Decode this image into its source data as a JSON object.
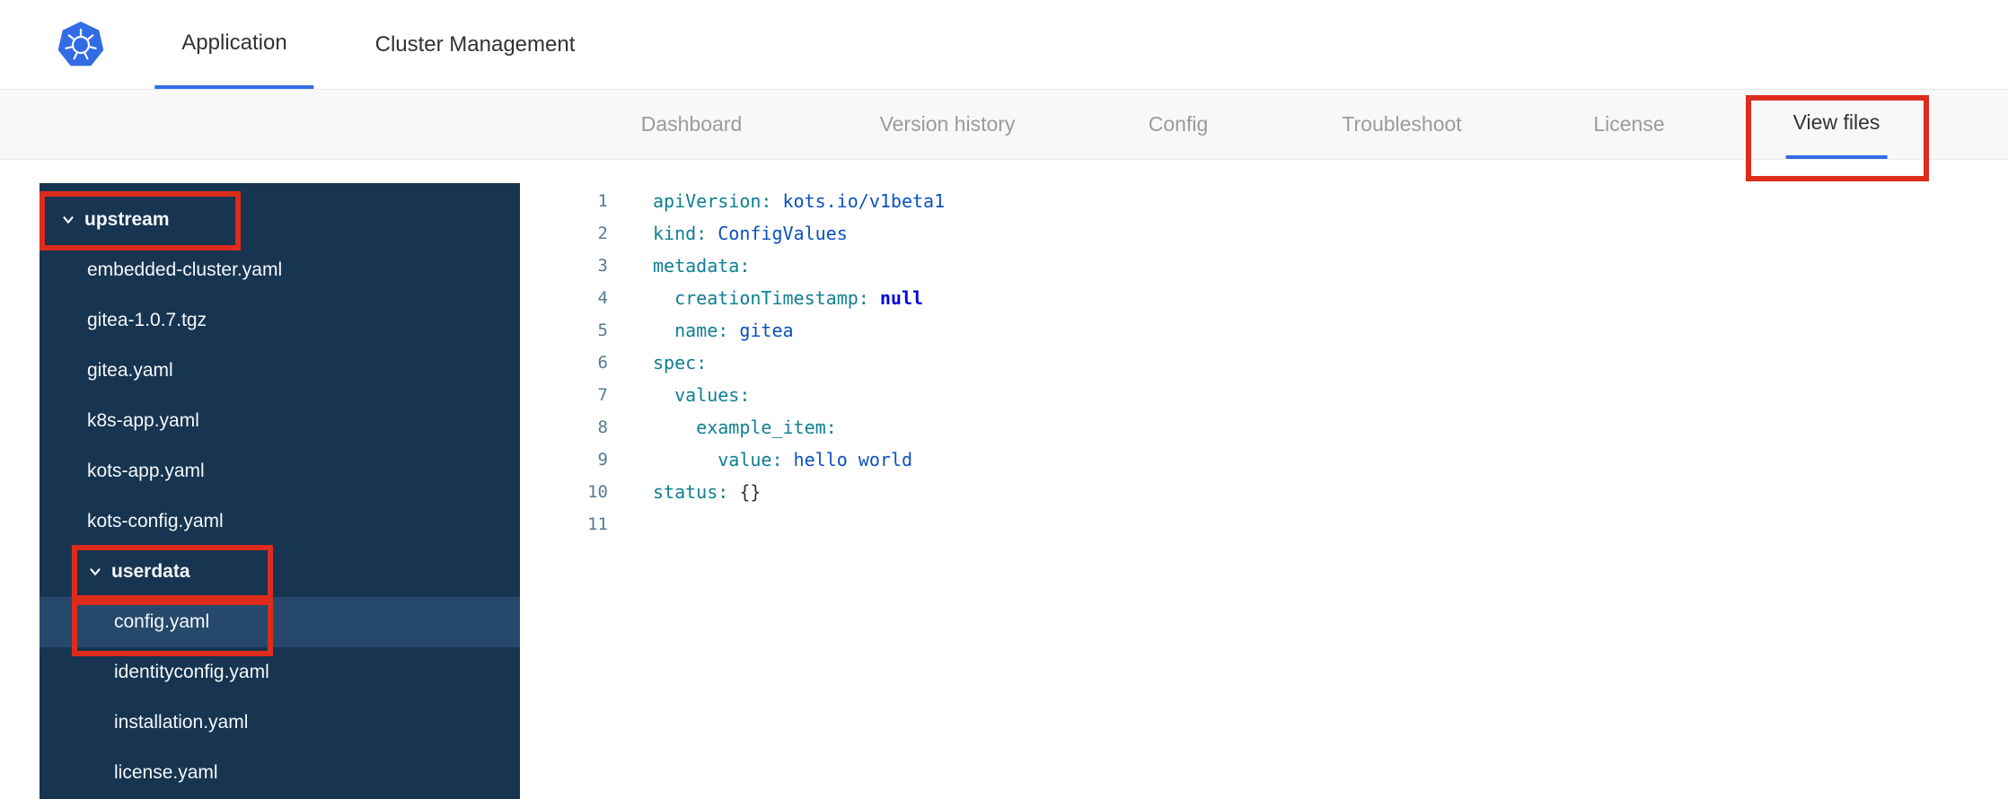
{
  "colors": {
    "accent-blue": "#326de6",
    "annotation-red": "#dd2b1c",
    "sidebar-bg": "#173450",
    "sidebar-selected": "#26496b",
    "nav-inactive": "#9b9b9b",
    "text-dark": "#323232",
    "code-key": "#0e7f93",
    "code-val": "#0b50c0",
    "code-kw": "#0000e0",
    "code-punct": "#333333",
    "line-num": "#557a95"
  },
  "header": {
    "logo": "kubernetes-logo",
    "tabs": [
      {
        "label": "Application",
        "active": true
      },
      {
        "label": "Cluster Management",
        "active": false
      }
    ]
  },
  "subnav": {
    "tabs": [
      {
        "label": "Dashboard",
        "active": false
      },
      {
        "label": "Version history",
        "active": false
      },
      {
        "label": "Config",
        "active": false
      },
      {
        "label": "Troubleshoot",
        "active": false
      },
      {
        "label": "License",
        "active": false
      },
      {
        "label": "View files",
        "active": true,
        "annotated": true
      }
    ]
  },
  "file_tree": {
    "items": [
      {
        "label": "upstream",
        "type": "dir",
        "depth": 0,
        "expanded": true,
        "annotated": true
      },
      {
        "label": "embedded-cluster.yaml",
        "type": "file",
        "depth": 1
      },
      {
        "label": "gitea-1.0.7.tgz",
        "type": "file",
        "depth": 1
      },
      {
        "label": "gitea.yaml",
        "type": "file",
        "depth": 1
      },
      {
        "label": "k8s-app.yaml",
        "type": "file",
        "depth": 1
      },
      {
        "label": "kots-app.yaml",
        "type": "file",
        "depth": 1
      },
      {
        "label": "kots-config.yaml",
        "type": "file",
        "depth": 1
      },
      {
        "label": "userdata",
        "type": "dir",
        "depth": 1,
        "expanded": true,
        "annotated": true
      },
      {
        "label": "config.yaml",
        "type": "file",
        "depth": 2,
        "selected": true,
        "annotated": true
      },
      {
        "label": "identityconfig.yaml",
        "type": "file",
        "depth": 2
      },
      {
        "label": "installation.yaml",
        "type": "file",
        "depth": 2
      },
      {
        "label": "license.yaml",
        "type": "file",
        "depth": 2
      }
    ]
  },
  "editor": {
    "lines": [
      {
        "num": 1,
        "tokens": [
          {
            "text": "apiVersion:",
            "cls": "key"
          },
          {
            "text": " kots.io/v1beta1",
            "cls": "val"
          }
        ]
      },
      {
        "num": 2,
        "tokens": [
          {
            "text": "kind:",
            "cls": "key"
          },
          {
            "text": " ConfigValues",
            "cls": "val"
          }
        ]
      },
      {
        "num": 3,
        "tokens": [
          {
            "text": "metadata:",
            "cls": "key"
          }
        ]
      },
      {
        "num": 4,
        "tokens": [
          {
            "text": "  creationTimestamp:",
            "cls": "key"
          },
          {
            "text": " null",
            "cls": "kw"
          }
        ]
      },
      {
        "num": 5,
        "tokens": [
          {
            "text": "  name:",
            "cls": "key"
          },
          {
            "text": " gitea",
            "cls": "val"
          }
        ]
      },
      {
        "num": 6,
        "tokens": [
          {
            "text": "spec:",
            "cls": "key"
          }
        ]
      },
      {
        "num": 7,
        "tokens": [
          {
            "text": "  values:",
            "cls": "key"
          }
        ]
      },
      {
        "num": 8,
        "tokens": [
          {
            "text": "    example_item:",
            "cls": "key"
          }
        ]
      },
      {
        "num": 9,
        "tokens": [
          {
            "text": "      value:",
            "cls": "key"
          },
          {
            "text": " hello world",
            "cls": "val"
          }
        ]
      },
      {
        "num": 10,
        "tokens": [
          {
            "text": "status:",
            "cls": "key"
          },
          {
            "text": " {}",
            "cls": "punct"
          }
        ]
      },
      {
        "num": 11,
        "tokens": []
      }
    ]
  },
  "annotations": [
    {
      "target": "view-files-tab"
    },
    {
      "target": "upstream-folder"
    },
    {
      "target": "userdata-folder"
    },
    {
      "target": "config-yaml-file"
    }
  ]
}
